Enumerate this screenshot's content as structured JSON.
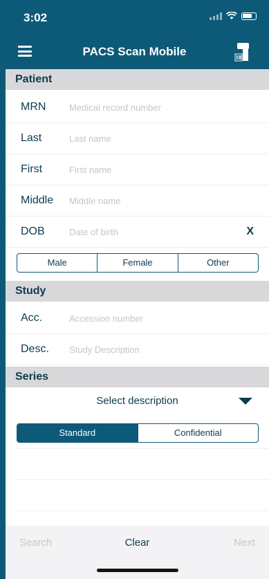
{
  "status_bar": {
    "time": "3:02"
  },
  "nav": {
    "title": "PACS Scan Mobile",
    "menu_icon": "hamburger-menu-icon",
    "scanner_icon": "barcode-scanner-icon"
  },
  "patient": {
    "header": "Patient",
    "fields": [
      {
        "label": "MRN",
        "placeholder": "Medical record number",
        "value": ""
      },
      {
        "label": "Last",
        "placeholder": "Last name",
        "value": ""
      },
      {
        "label": "First",
        "placeholder": "First name",
        "value": ""
      },
      {
        "label": "Middle",
        "placeholder": "Middle name",
        "value": ""
      },
      {
        "label": "DOB",
        "placeholder": "Date of birth",
        "value": ""
      }
    ],
    "dob_clear": "X",
    "sex_options": [
      "Male",
      "Female",
      "Other"
    ]
  },
  "study": {
    "header": "Study",
    "fields": [
      {
        "label": "Acc.",
        "placeholder": "Accession number",
        "value": ""
      },
      {
        "label": "Desc.",
        "placeholder": "Study Description",
        "value": ""
      }
    ]
  },
  "series": {
    "header": "Series",
    "select_label": "Select description",
    "privacy_options": [
      "Standard",
      "Confidential"
    ],
    "privacy_selected": "Standard"
  },
  "bottom_bar": {
    "search": "Search",
    "clear": "Clear",
    "next": "Next"
  },
  "colors": {
    "brand": "#0d5a78",
    "text_dark": "#0d3b4f",
    "section_bg": "#d8d8da"
  }
}
